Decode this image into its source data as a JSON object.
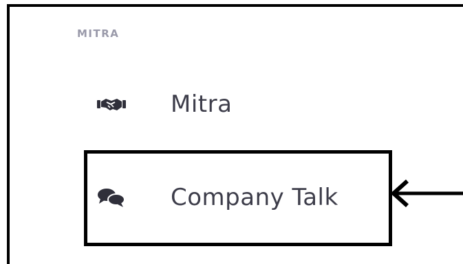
{
  "section": {
    "label": "MITRA"
  },
  "nav": {
    "items": [
      {
        "label": "Mitra",
        "icon": "handshake-icon"
      },
      {
        "label": "Company Talk",
        "icon": "chat-bubbles-icon"
      }
    ]
  },
  "colors": {
    "section_label": "#9a9aaa",
    "item_text": "#3d3d4a",
    "icon": "#2f2f3a",
    "annotation": "#000000"
  }
}
